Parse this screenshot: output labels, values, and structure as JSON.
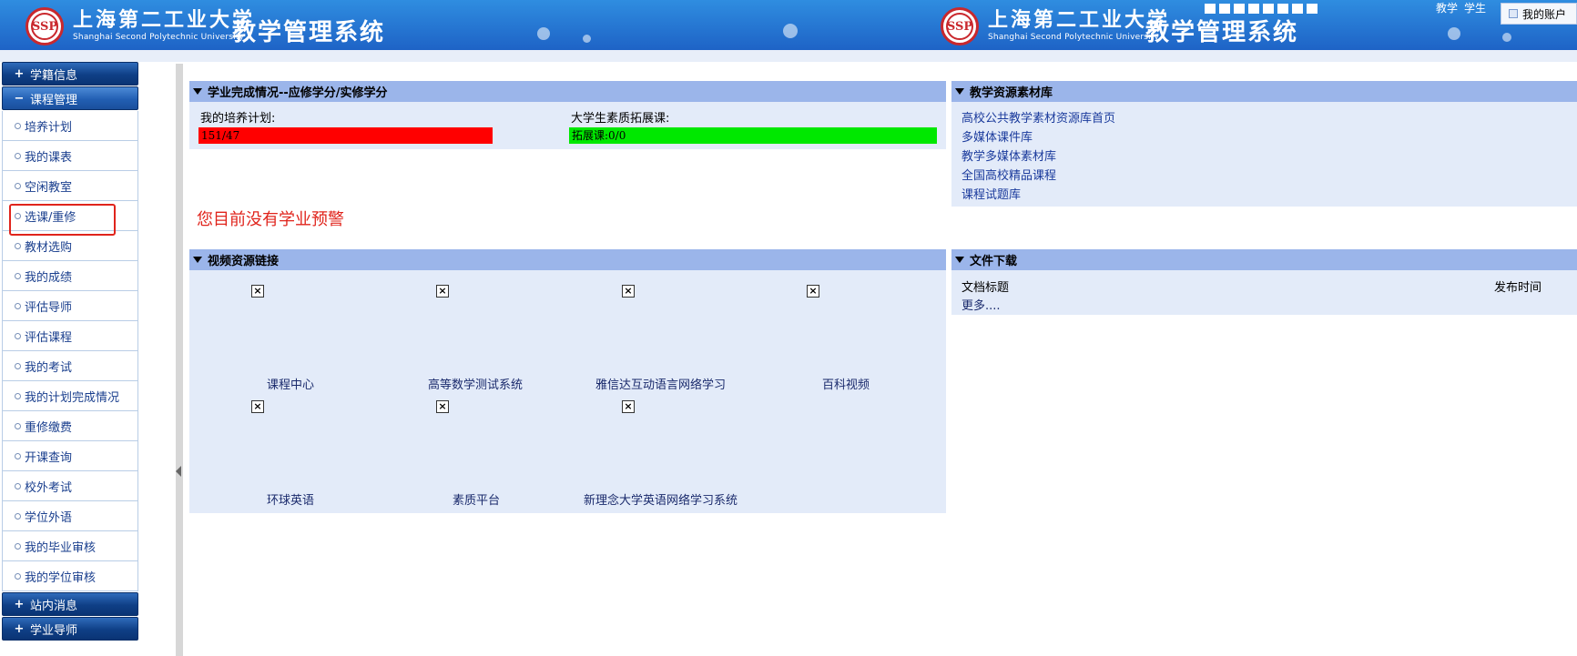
{
  "header": {
    "logo_text": "SSP",
    "university_cn": "上海第二工业大学",
    "university_en": "Shanghai Second Polytechnic University",
    "system_title": "教学管理系统",
    "nav": [
      "教学",
      "学生"
    ],
    "account_label": "我的账户",
    "colors": {
      "banner": "#2b86da",
      "accent_red": "#c9282d"
    }
  },
  "sidebar": {
    "groups_top": [
      {
        "label": "学籍信息",
        "symbol": "+",
        "expanded": false
      },
      {
        "label": "课程管理",
        "symbol": "−",
        "expanded": true
      }
    ],
    "course_items": [
      {
        "label": "培养计划"
      },
      {
        "label": "我的课表"
      },
      {
        "label": "空闲教室"
      },
      {
        "label": "选课/重修",
        "highlighted": true
      },
      {
        "label": "教材选购"
      },
      {
        "label": "我的成绩"
      },
      {
        "label": "评估导师"
      },
      {
        "label": "评估课程"
      },
      {
        "label": "我的考试"
      },
      {
        "label": "我的计划完成情况"
      },
      {
        "label": "重修缴费"
      },
      {
        "label": "开课查询"
      },
      {
        "label": "校外考试"
      },
      {
        "label": "学位外语"
      },
      {
        "label": "我的毕业审核"
      },
      {
        "label": "我的学位审核"
      }
    ],
    "groups_bottom": [
      {
        "label": "站内消息",
        "symbol": "+",
        "expanded": false
      },
      {
        "label": "学业导师",
        "symbol": "+",
        "expanded": false
      }
    ]
  },
  "academic": {
    "title": "学业完成情况--应修学分/实修学分",
    "plan_label": "我的培养计划:",
    "plan_value": "151/47",
    "quality_label": "大学生素质拓展课:",
    "quality_value": "拓展课:0/0",
    "colors": {
      "plan_bar": "#ff0000",
      "quality_bar": "#00e800"
    }
  },
  "warning_text": "您目前没有学业预警",
  "resources": {
    "title": "教学资源素材库",
    "links": [
      "高校公共教学素材资源库首页",
      "多媒体课件库",
      "教学多媒体素材库",
      "全国高校精品课程",
      "课程试题库"
    ]
  },
  "videos": {
    "title": "视频资源链接",
    "items": [
      {
        "label": "课程中心",
        "icon": "broken-image-icon"
      },
      {
        "label": "高等数学测试系统",
        "icon": "broken-image-icon"
      },
      {
        "label": "雅信达互动语言网络学习",
        "icon": "broken-image-icon"
      },
      {
        "label": "百科视频",
        "icon": "broken-image-icon"
      },
      {
        "label": "环球英语",
        "icon": "broken-image-icon"
      },
      {
        "label": "素质平台",
        "icon": "broken-image-icon"
      },
      {
        "label": "新理念大学英语网络学习系统",
        "icon": "broken-image-icon"
      }
    ]
  },
  "files": {
    "title": "文件下载",
    "col_title": "文档标题",
    "col_date": "发布时间",
    "more": "更多...."
  }
}
